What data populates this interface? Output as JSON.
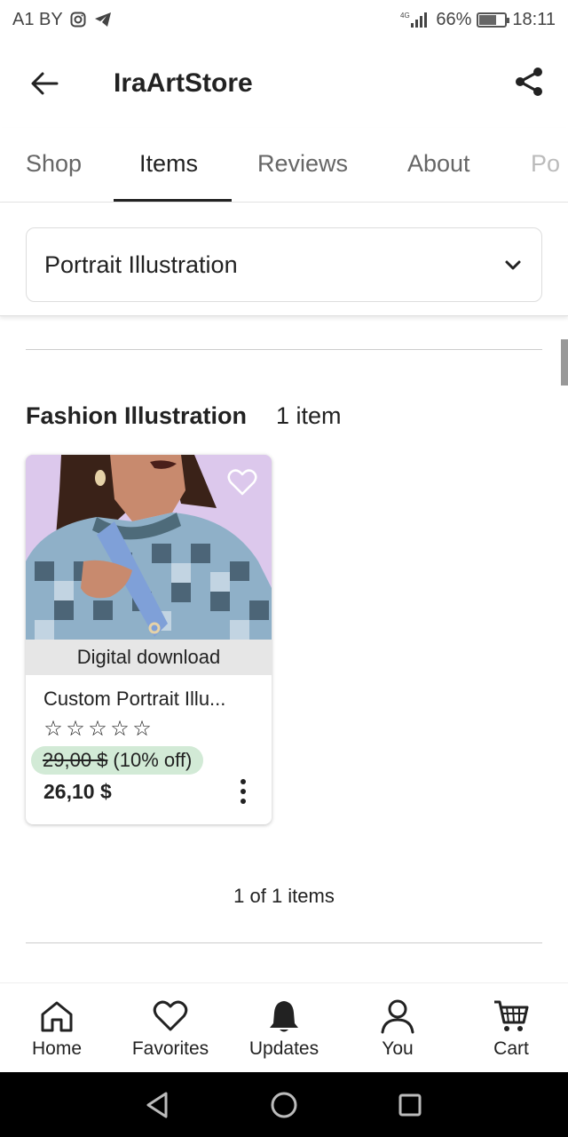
{
  "status_bar": {
    "carrier": "A1 BY",
    "network": "4G",
    "battery_text": "66%",
    "battery_level": 0.66,
    "time": "18:11"
  },
  "header": {
    "title": "IraArtStore"
  },
  "tabs": [
    {
      "label": "Shop",
      "active": false
    },
    {
      "label": "Items",
      "active": true
    },
    {
      "label": "Reviews",
      "active": false
    },
    {
      "label": "About",
      "active": false
    },
    {
      "label": "Po",
      "active": false
    }
  ],
  "filter": {
    "selected": "Portrait Illustration"
  },
  "section": {
    "title": "Fashion Illustration",
    "count": "1 item"
  },
  "listing": {
    "badge": "Digital download",
    "title": "Custom Portrait Illu...",
    "rating_stars": 5,
    "rating_filled": 0,
    "star_glyph": "☆",
    "old_price": "29,00 $",
    "discount": "(10% off)",
    "price": "26,10 $"
  },
  "pager": {
    "text": "1 of 1 items"
  },
  "bottom_nav": [
    {
      "label": "Home",
      "icon": "home-icon"
    },
    {
      "label": "Favorites",
      "icon": "heart-icon"
    },
    {
      "label": "Updates",
      "icon": "bell-icon"
    },
    {
      "label": "You",
      "icon": "person-icon"
    },
    {
      "label": "Cart",
      "icon": "cart-icon"
    }
  ],
  "colors": {
    "accent": "#222222",
    "discount_bg": "#d2ead6",
    "image_bg": "#dcc8ec"
  }
}
